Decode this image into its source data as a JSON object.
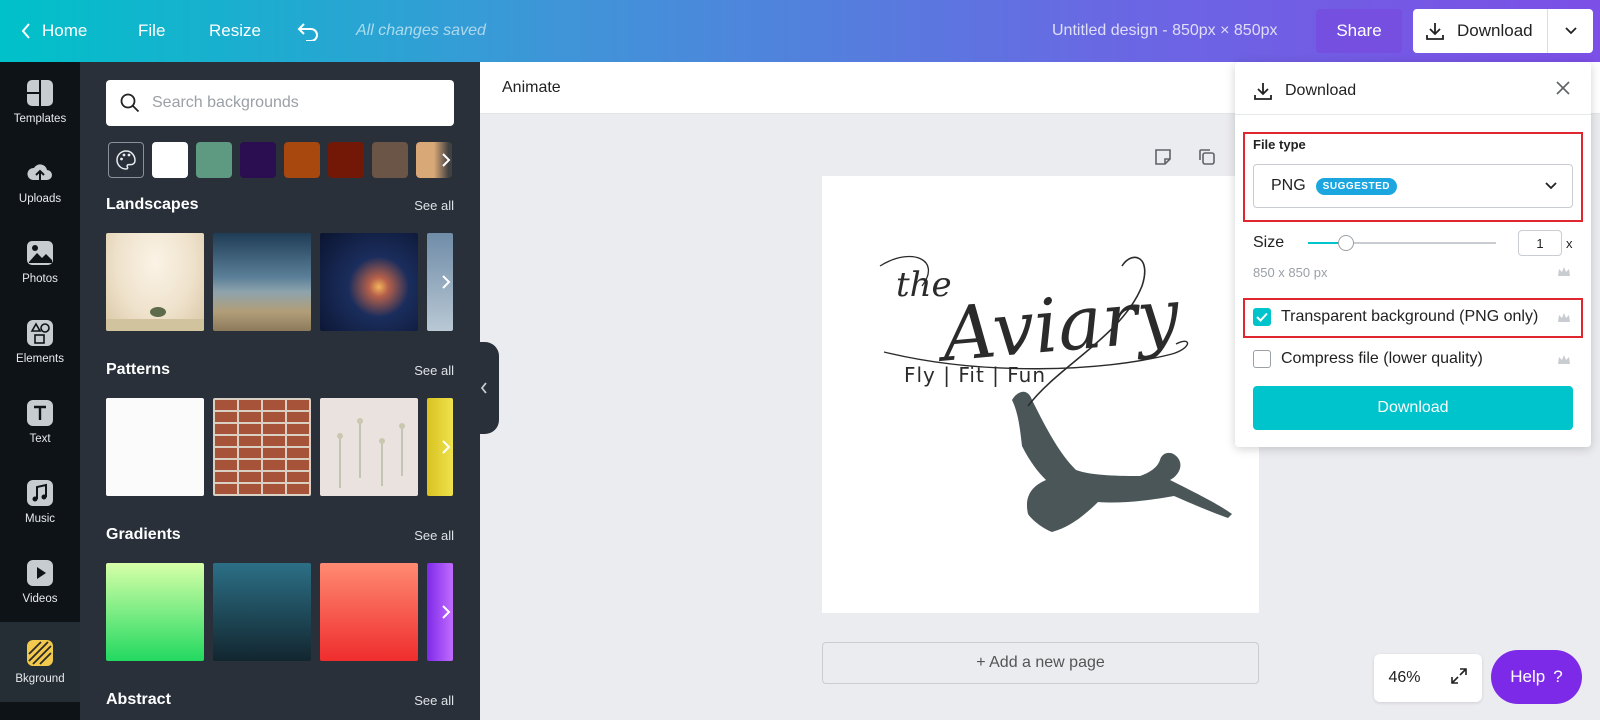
{
  "topbar": {
    "home": "Home",
    "file": "File",
    "resize": "Resize",
    "saved_status": "All changes saved",
    "design_title": "Untitled design - 850px × 850px",
    "share": "Share",
    "download": "Download"
  },
  "rail": {
    "items": [
      {
        "label": "Templates",
        "icon": "templates-icon"
      },
      {
        "label": "Uploads",
        "icon": "uploads-icon"
      },
      {
        "label": "Photos",
        "icon": "photos-icon"
      },
      {
        "label": "Elements",
        "icon": "elements-icon"
      },
      {
        "label": "Text",
        "icon": "text-icon"
      },
      {
        "label": "Music",
        "icon": "music-icon"
      },
      {
        "label": "Videos",
        "icon": "videos-icon"
      },
      {
        "label": "Bkground",
        "icon": "background-icon"
      }
    ],
    "active": "Bkground"
  },
  "panel": {
    "search_placeholder": "Search backgrounds",
    "swatch_colors": [
      "#ffffff",
      "#5e9a82",
      "#2b0e52",
      "#a8470e",
      "#731707",
      "#6b5546",
      "#d8a877"
    ],
    "see_all": "See all",
    "sections": [
      {
        "title": "Landscapes"
      },
      {
        "title": "Patterns"
      },
      {
        "title": "Gradients"
      },
      {
        "title": "Abstract"
      }
    ]
  },
  "editor": {
    "animate": "Animate",
    "add_page": "+ Add a new page",
    "zoom": "46%",
    "help": "Help",
    "help_symbol": "?"
  },
  "artwork": {
    "the": "the",
    "name": "Aviary",
    "tagline": "Fly | Fit | Fun"
  },
  "download_panel": {
    "title": "Download",
    "file_type_label": "File type",
    "file_type_value": "PNG",
    "suggested_badge": "SUGGESTED",
    "size_label": "Size",
    "size_value": "1",
    "size_suffix": "x",
    "size_slider_fraction": 0.2,
    "dimensions": "850 x 850 px",
    "transparent_label": "Transparent background (PNG only)",
    "transparent_checked": true,
    "compress_label": "Compress file (lower quality)",
    "compress_checked": false,
    "download_button": "Download"
  },
  "colors": {
    "accent": "#00c4cc",
    "help_purple": "#7d2ae8",
    "highlight_red": "#e0262e",
    "panel_bg": "#293039",
    "rail_bg": "#0e1318"
  }
}
